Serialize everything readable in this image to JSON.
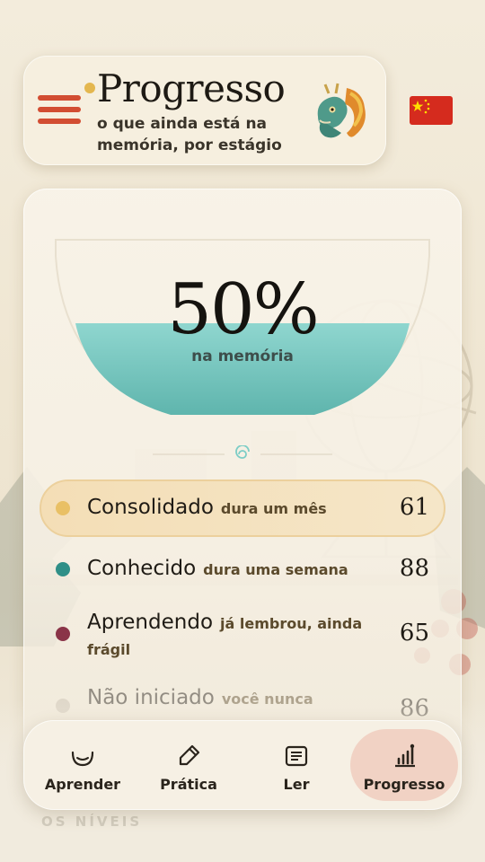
{
  "header": {
    "title": "Progresso",
    "subtitle": "o que ainda está na memória, por estágio",
    "mascot_icon": "dragon-icon",
    "flag_icon": "china-flag-icon",
    "menu_icon": "hamburger-menu-icon"
  },
  "memory": {
    "percent_text": "50%",
    "percent_value": 50,
    "label": "na memória"
  },
  "stages": [
    {
      "name": "Consolidado",
      "desc": "dura um mês",
      "count": "61",
      "color": "#e9c065",
      "active": true
    },
    {
      "name": "Conhecido",
      "desc": "dura uma semana",
      "count": "88",
      "color": "#2f8f87",
      "active": false
    },
    {
      "name": "Aprendendo",
      "desc": "já lembrou, ainda",
      "desc2": "frágil",
      "count": "65",
      "color": "#8a3448",
      "active": false
    },
    {
      "name": "Não iniciado",
      "desc": "você nunca",
      "count": "86",
      "color": "#c9c1b2",
      "active": false
    }
  ],
  "section_hint": "OS NÍVEIS",
  "nav": [
    {
      "label": "Aprender",
      "icon": "bowl-icon",
      "active": false
    },
    {
      "label": "Prática",
      "icon": "brush-icon",
      "active": false
    },
    {
      "label": "Ler",
      "icon": "book-icon",
      "active": false
    },
    {
      "label": "Progresso",
      "icon": "bar-chart-icon",
      "active": true
    }
  ],
  "colors": {
    "accent_red": "#d24d32",
    "accent_gold": "#e4b74f",
    "tea": "#7ccdc6",
    "active_nav": "#f1d2c4"
  }
}
